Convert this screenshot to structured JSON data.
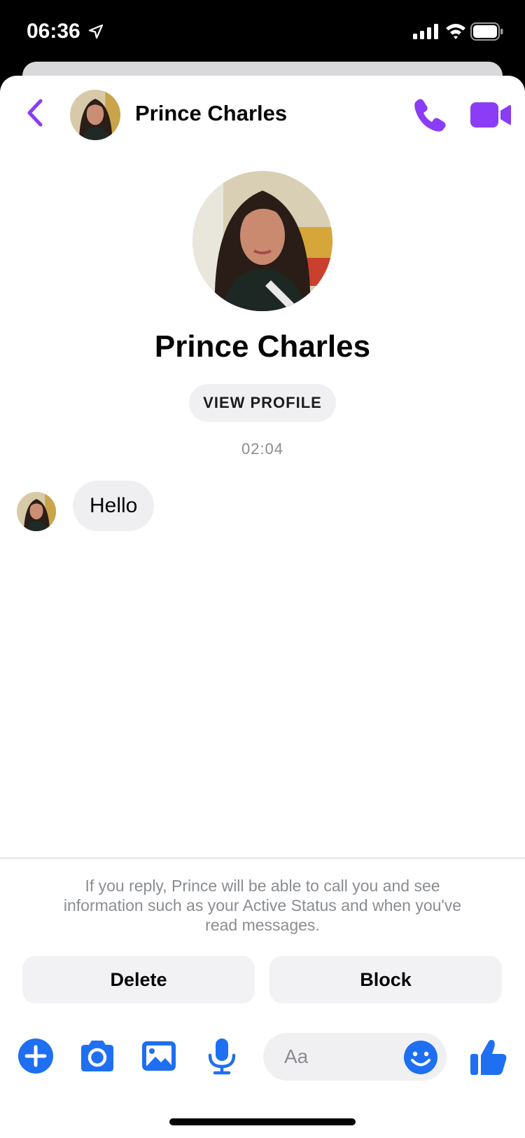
{
  "status_bar": {
    "time": "06:36",
    "icons": [
      "location-arrow-icon",
      "signal-icon",
      "wifi-icon",
      "battery-icon"
    ]
  },
  "header": {
    "name": "Prince Charles",
    "back_icon": "chevron-left-icon",
    "call_icon": "phone-icon",
    "video_icon": "video-camera-icon"
  },
  "profile": {
    "name": "Prince Charles",
    "view_profile_label": "VIEW PROFILE"
  },
  "conversation": {
    "timestamp": "02:04",
    "messages": [
      {
        "sender": "Prince Charles",
        "text": "Hello"
      }
    ]
  },
  "request": {
    "notice": "If you reply, Prince will be able to call you and see information such as your Active Status and when you've read messages.",
    "delete_label": "Delete",
    "block_label": "Block"
  },
  "composer": {
    "placeholder": "Aa",
    "icons": [
      "plus-icon",
      "camera-icon",
      "gallery-icon",
      "microphone-icon",
      "emoji-icon",
      "thumbs-up-icon"
    ]
  },
  "colors": {
    "accent_purple": "#8b3cf6",
    "accent_blue": "#1e6ff1"
  }
}
